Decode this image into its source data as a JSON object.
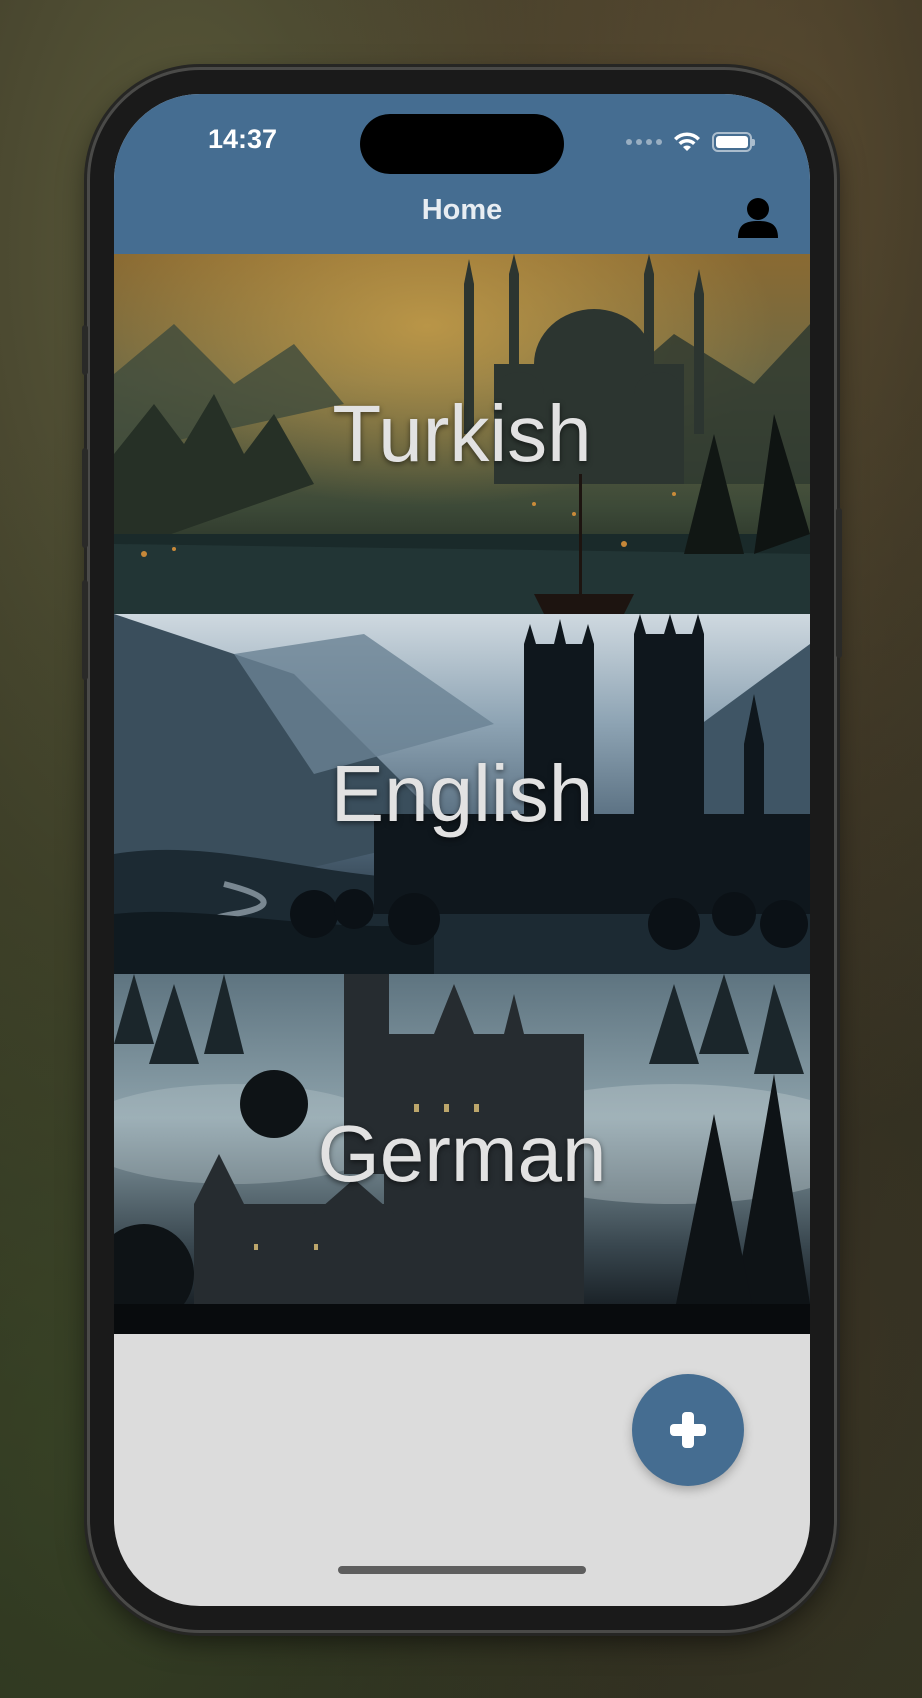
{
  "status_bar": {
    "time": "14:37",
    "icons": [
      "signal-dots-icon",
      "wifi-icon",
      "battery-icon"
    ]
  },
  "header": {
    "title": "Home",
    "profile_icon": "person-icon",
    "color": "#456d91"
  },
  "languages": [
    {
      "label": "Turkish",
      "scene": "mosque-at-dusk"
    },
    {
      "label": "English",
      "scene": "gothic-castle-in-misty-valley"
    },
    {
      "label": "German",
      "scene": "castle-in-foggy-forest"
    }
  ],
  "fab": {
    "icon": "plus-icon",
    "color": "#456d91"
  },
  "colors": {
    "background": "#dcdcdc",
    "accent": "#456d91"
  }
}
